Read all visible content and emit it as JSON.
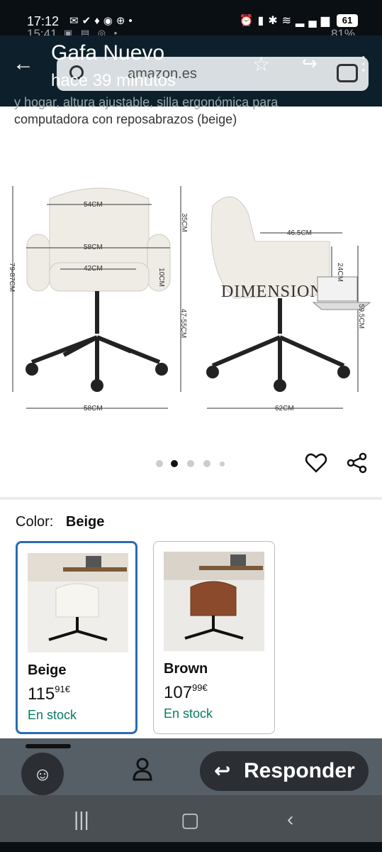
{
  "status": {
    "time": "17:12",
    "time_ghost": "15:41",
    "battery": "61",
    "battery_ghost": "81%"
  },
  "notification": {
    "title": "Gafa Nuevo",
    "subtitle": "hace 39 minutos",
    "search_text": "amazon.es"
  },
  "product": {
    "title_faded": "y hogar, altura ajustable, silla ergonómica para",
    "title_line": "computadora con reposabrazos (beige)",
    "image_header": "DIMENSIONS",
    "measurements": {
      "front_width_top": "54CM",
      "front_width_mid": "58CM",
      "front_width_inner": "42CM",
      "front_height_arm": "35CM",
      "front_height_cushion": "10CM",
      "front_height_total": "79-87CM",
      "front_height_base": "47-55CM",
      "front_base_width": "58CM",
      "side_depth_top": "46.5CM",
      "side_height_arm": "24CM",
      "side_height": "59.5CM",
      "side_base_width": "62CM"
    }
  },
  "carousel": {
    "total": 5,
    "active": 1
  },
  "color": {
    "label": "Color:",
    "value": "Beige",
    "options": [
      {
        "name": "Beige",
        "price_whole": "115",
        "price_fraction": "91",
        "currency": "€",
        "stock": "En stock",
        "selected": true,
        "swatch": "#ece7df"
      },
      {
        "name": "Brown",
        "price_whole": "107",
        "price_fraction": "99",
        "currency": "€",
        "stock": "En stock",
        "selected": false,
        "swatch": "#8a4a2b"
      }
    ]
  },
  "reply": {
    "label": "Responder"
  }
}
